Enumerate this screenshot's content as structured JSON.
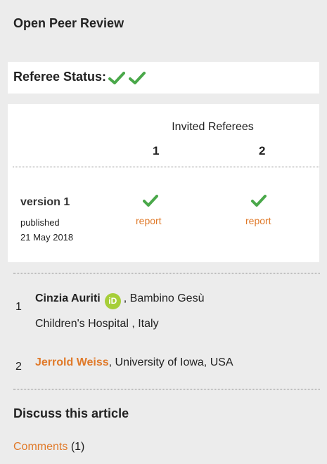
{
  "panel": {
    "title": "Open Peer Review"
  },
  "referee_status": {
    "label": "Referee Status:",
    "checks": 2,
    "check_color": "#4aa84a"
  },
  "table": {
    "invited_header": "Invited Referees",
    "referee_numbers": [
      "1",
      "2"
    ],
    "version": {
      "label": "version 1",
      "published_label": "published",
      "date": "21 May 2018",
      "reports": [
        "report",
        "report"
      ]
    }
  },
  "referees": [
    {
      "number": "1",
      "name": "Cinzia Auriti",
      "orcid_icon": "iD",
      "affiliation_line1": ", Bambino Gesù",
      "affiliation_line2": "Children's Hospital , Italy"
    },
    {
      "number": "2",
      "name": "Jerrold Weiss",
      "affiliation": ", University of Iowa, USA"
    }
  ],
  "discuss": {
    "title": "Discuss this article",
    "comments_link": "Comments",
    "comments_count": "(1)"
  },
  "colors": {
    "link": "#e07a2a",
    "check": "#4aa84a",
    "orcid": "#a6ce39"
  }
}
